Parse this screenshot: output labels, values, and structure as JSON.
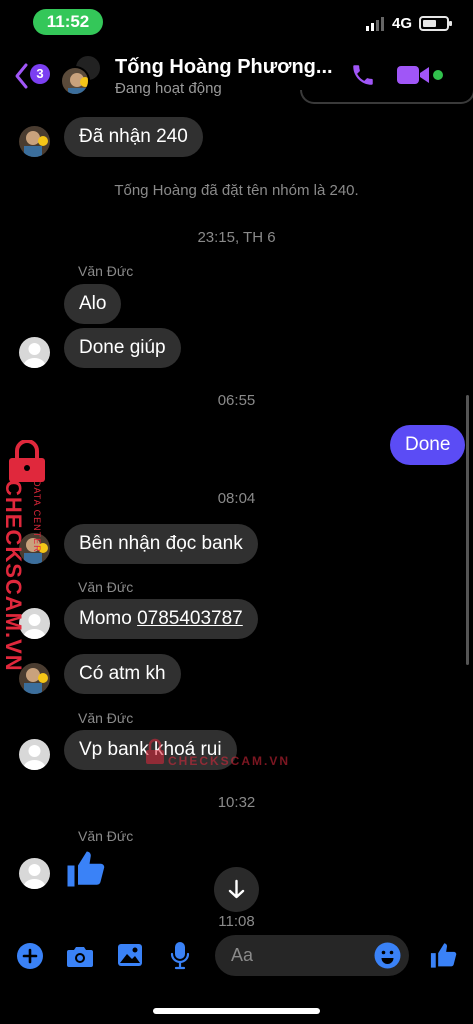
{
  "status_bar": {
    "time": "11:52",
    "network": "4G"
  },
  "header": {
    "unread_count": "3",
    "title": "Tống Hoàng Phương...",
    "subtitle": "Đang hoạt động",
    "accent_color": "#a056f7"
  },
  "messages": [
    {
      "type": "in",
      "text": "Đã nhận 240",
      "avatar": "photo"
    },
    {
      "type": "system",
      "text": "Tống Hoàng đã đặt tên nhóm là 240."
    },
    {
      "type": "time",
      "text": "23:15, TH 6"
    },
    {
      "type": "sender",
      "text": "Văn Đức"
    },
    {
      "type": "in",
      "text": "Alo"
    },
    {
      "type": "in",
      "text": "Done giúp",
      "avatar": "default"
    },
    {
      "type": "time",
      "text": "06:55"
    },
    {
      "type": "out",
      "text": "Done"
    },
    {
      "type": "time",
      "text": "08:04"
    },
    {
      "type": "in",
      "text": "Bên nhận đọc bank",
      "avatar": "photo"
    },
    {
      "type": "sender",
      "text": "Văn Đức"
    },
    {
      "type": "in",
      "text_prefix": "Momo ",
      "text_link": "0785403787",
      "avatar": "default"
    },
    {
      "type": "in",
      "text": "Có atm kh",
      "avatar": "photo"
    },
    {
      "type": "sender",
      "text": "Văn Đức"
    },
    {
      "type": "in",
      "text": "Vp bank khoá rui",
      "avatar": "default"
    },
    {
      "type": "time",
      "text": "10:32"
    },
    {
      "type": "sender",
      "text": "Văn Đức"
    },
    {
      "type": "in_like",
      "icon": "thumbs-up-icon",
      "avatar": "default"
    }
  ],
  "scroll_time": "11:08",
  "watermark": {
    "brand": "CHECKSCAM.VN",
    "tagline": "DATA CENTER"
  },
  "composer": {
    "placeholder": "Aa"
  },
  "colors": {
    "bubble_in": "#303030",
    "bubble_out": "#5b4cf5",
    "icon_blue": "#3a82f7"
  }
}
